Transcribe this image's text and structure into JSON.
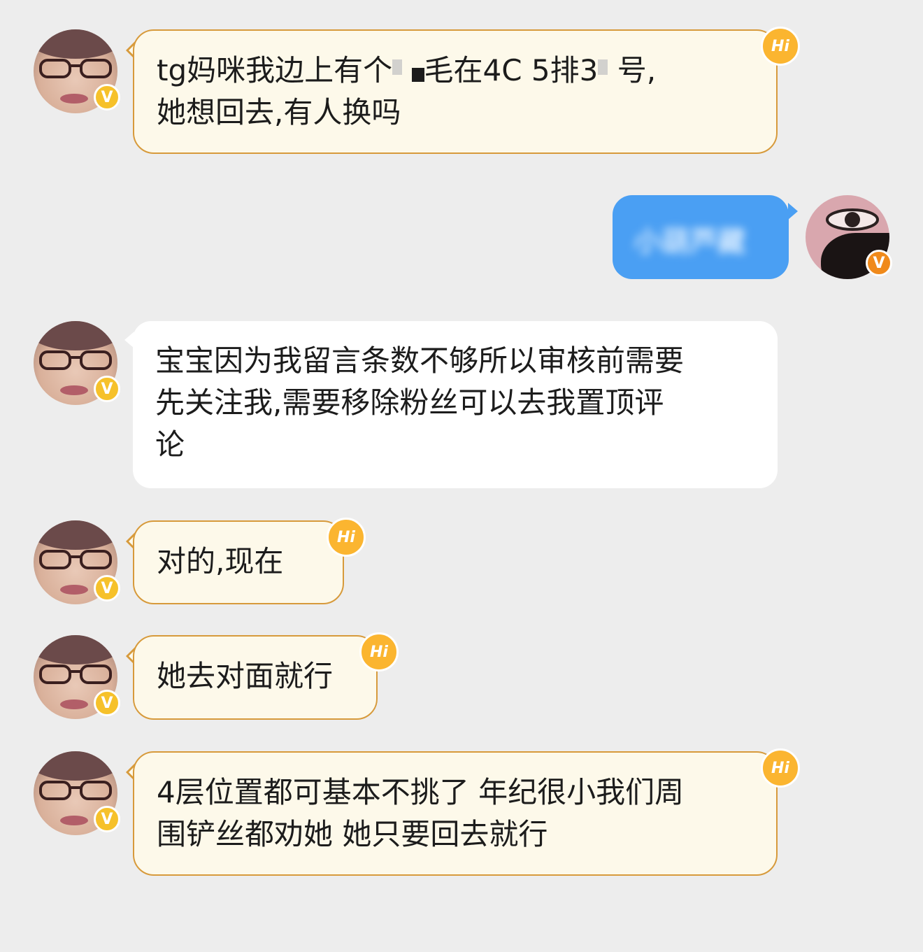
{
  "messages": [
    {
      "id": 1,
      "side": "left",
      "style": "hi",
      "lines": [
        "tg妈咪我边上有个",
        "毛在4C 5排3",
        "号,",
        "她想回去,有人换吗"
      ]
    },
    {
      "id": 2,
      "side": "right",
      "style": "mine",
      "text": "小葫芦藏"
    },
    {
      "id": 3,
      "side": "left",
      "style": "plain",
      "lines": [
        "宝宝因为我留言条数不够所以审核前需要",
        "先关注我,需要移除粉丝可以去我置顶评",
        "论"
      ]
    },
    {
      "id": 4,
      "side": "left",
      "style": "hi",
      "lines": [
        "对的,现在"
      ]
    },
    {
      "id": 5,
      "side": "left",
      "style": "hi",
      "lines": [
        "她去对面就行"
      ]
    },
    {
      "id": 6,
      "side": "left",
      "style": "hi",
      "lines": [
        "4层位置都可基本不挑了 年纪很小我们周",
        "围铲丝都劝她 她只要回去就行"
      ]
    }
  ],
  "badges": {
    "verified": "V",
    "hi": "Hi"
  },
  "colors": {
    "background": "#ededed",
    "hi_bubble": "#fdf9ea",
    "hi_border": "#d79a3b",
    "mine_bubble": "#4a9ff3",
    "verified_yellow": "#f6c12a",
    "verified_orange": "#f08a1b"
  }
}
